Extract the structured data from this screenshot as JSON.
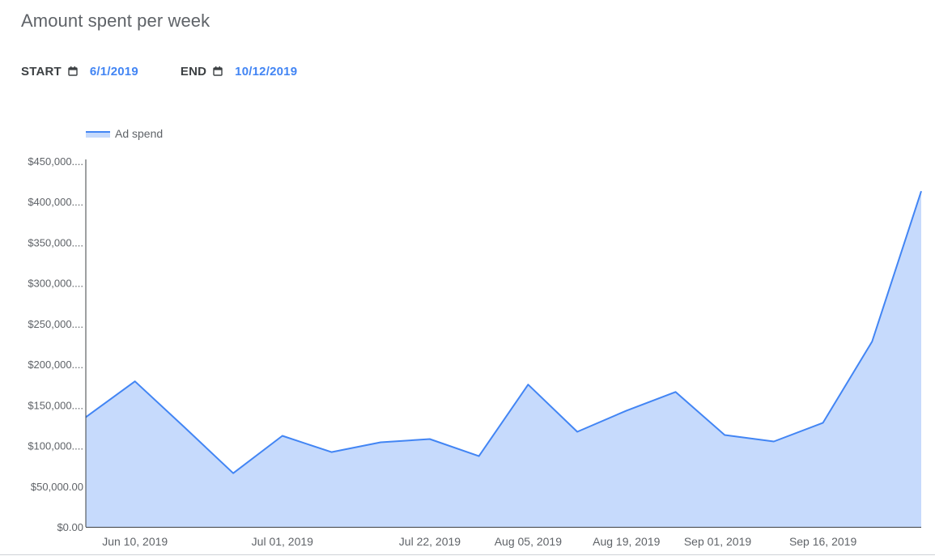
{
  "page": {
    "title": "Amount spent per week"
  },
  "date_range": {
    "start_label": "START",
    "start_value": "6/1/2019",
    "end_label": "END",
    "end_value": "10/12/2019",
    "icon": "calendar-icon"
  },
  "colors": {
    "line": "#4285f4",
    "area": "#c6dafc",
    "date_value": "#4285f4",
    "axis_text": "#5f6368",
    "axis_line": "#3c4043"
  },
  "chart_data": {
    "type": "area",
    "series": [
      {
        "name": "Ad spend",
        "x": [
          "2019-06-03",
          "2019-06-10",
          "2019-06-17",
          "2019-06-24",
          "2019-07-01",
          "2019-07-08",
          "2019-07-15",
          "2019-07-22",
          "2019-07-29",
          "2019-08-05",
          "2019-08-12",
          "2019-08-19",
          "2019-08-26",
          "2019-09-02",
          "2019-09-09",
          "2019-09-16",
          "2019-09-23",
          "2019-09-30"
        ],
        "values": [
          135000,
          179000,
          123000,
          66000,
          112000,
          92000,
          104000,
          108000,
          87000,
          175000,
          117000,
          143000,
          166000,
          113000,
          105000,
          128000,
          228000,
          413000
        ]
      }
    ],
    "x_tick_labels": [
      "Jun 10, 2019",
      "Jul 01, 2019",
      "Jul 22, 2019",
      "Aug 05, 2019",
      "Aug 19, 2019",
      "Sep 01, 2019",
      "Sep 16, 2019"
    ],
    "y_tick_labels": [
      "$450,000....",
      "$400,000....",
      "$350,000....",
      "$300,000....",
      "$250,000....",
      "$200,000....",
      "$150,000....",
      "$100,000....",
      "$50,000.00",
      "$0.00"
    ],
    "y_ticks": [
      450000,
      400000,
      350000,
      300000,
      250000,
      200000,
      150000,
      100000,
      50000,
      0
    ],
    "ylim": [
      0,
      450000
    ],
    "grid": false,
    "legend_position": "top-left"
  }
}
